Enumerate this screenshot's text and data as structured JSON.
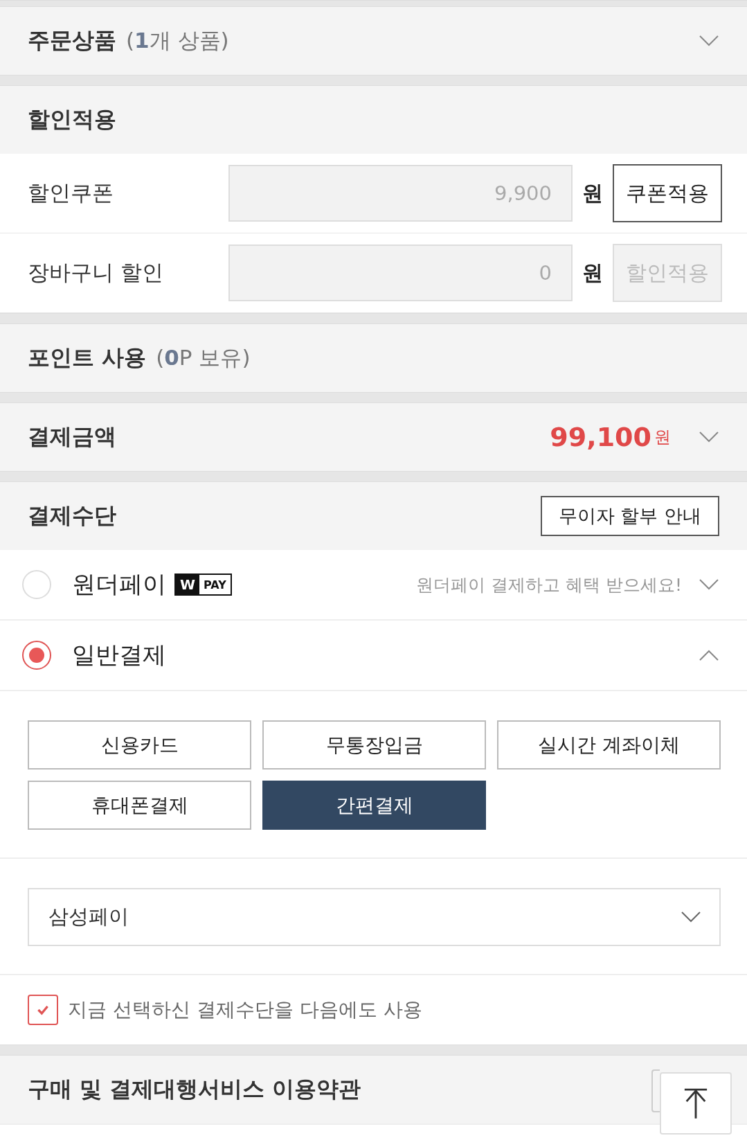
{
  "order_items": {
    "title": "주문상품",
    "summary": "(**1**개 상품)",
    "expanded": false
  },
  "discount": {
    "title": "할인적용",
    "rows": [
      {
        "label": "할인쿠폰",
        "value": "9,900",
        "unit": "원",
        "button": {
          "label": "쿠폰적용",
          "disabled": false
        }
      },
      {
        "label": "장바구니 할인",
        "value": "0",
        "unit": "원",
        "button": {
          "label": "할인적용",
          "disabled": true
        }
      }
    ]
  },
  "points": {
    "title": "포인트 사용",
    "summary": "(**0**P 보유)"
  },
  "payment_amount": {
    "title": "결제금액",
    "amount": "99,100",
    "unit": "원",
    "expanded": false
  },
  "payment_method": {
    "title": "결제수단",
    "info_button": "무이자 할부 안내",
    "options": [
      {
        "label": "원더페이",
        "badge": {
          "mark": "W",
          "text": "PAY"
        },
        "note": "원더페이 결제하고 혜택 받으세요!",
        "selected": false,
        "expanded": false
      },
      {
        "label": "일반결제",
        "selected": true,
        "expanded": true
      }
    ],
    "methods": [
      {
        "label": "신용카드",
        "selected": false
      },
      {
        "label": "무통장입금",
        "selected": false
      },
      {
        "label": "실시간 계좌이체",
        "selected": false
      },
      {
        "label": "휴대폰결제",
        "selected": false
      },
      {
        "label": "간편결제",
        "selected": true
      }
    ],
    "easy_pay_select": {
      "value": "삼성페이"
    },
    "remember": {
      "label": "지금 선택하신 결제수단을 다음에도 사용",
      "checked": true
    }
  },
  "terms": {
    "title": "구매 및 결제대행서비스 이용약관"
  }
}
